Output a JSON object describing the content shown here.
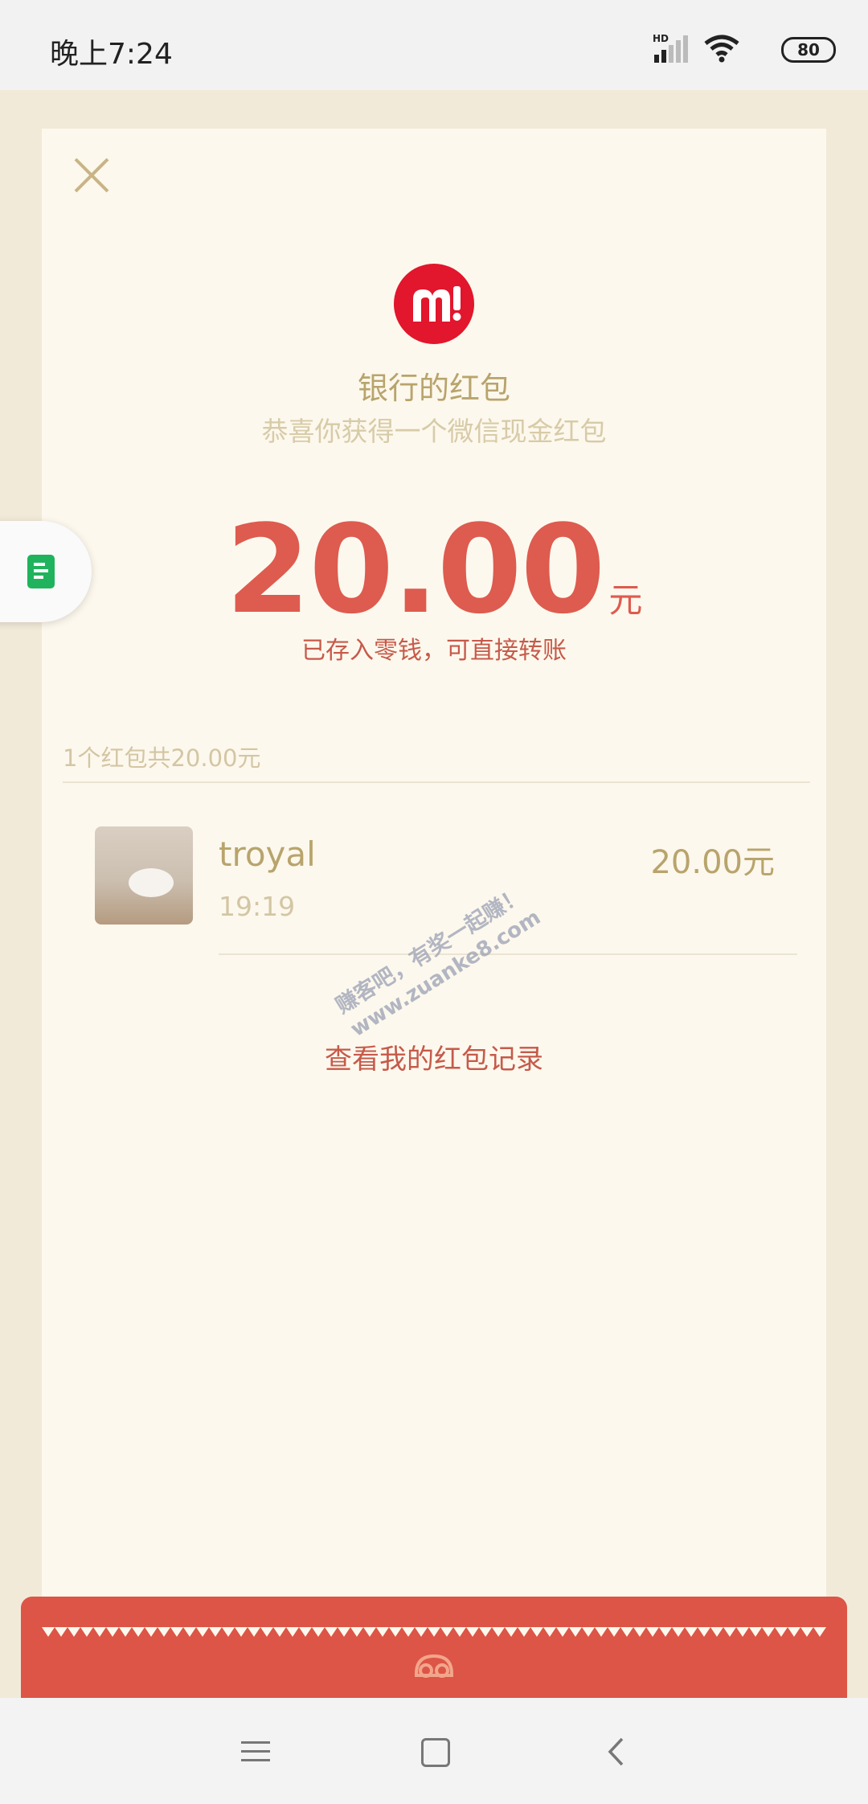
{
  "status_bar": {
    "time": "晚上7:24",
    "network_label": "HD",
    "battery": "80"
  },
  "packet": {
    "sender_title": "银行的红包",
    "subtitle": "恭喜你获得一个微信现金红包",
    "amount": "20.00",
    "unit": "元",
    "saved_note": "已存入零钱，可直接转账",
    "summary": "1个红包共20.00元"
  },
  "records": [
    {
      "name": "troyal",
      "time": "19:19",
      "amount": "20.00元"
    }
  ],
  "watermark": {
    "line1": "赚客吧，有奖一起赚！",
    "line2": "www.zuanke8.com"
  },
  "view_records_link": "查看我的红包记录",
  "colors": {
    "accent_red": "#de5b4f",
    "gold_text": "#b8a46c",
    "footer_red": "#dc5546",
    "card_bg": "#fdf8ed",
    "page_bg": "#f2ead9",
    "side_icon_green": "#1fb35d"
  },
  "icons": [
    "close-icon",
    "bank-logo-icon",
    "document-icon",
    "footer-emblem-icon",
    "nav-menu-icon",
    "nav-home-icon",
    "nav-back-icon",
    "signal-icon",
    "wifi-icon"
  ]
}
